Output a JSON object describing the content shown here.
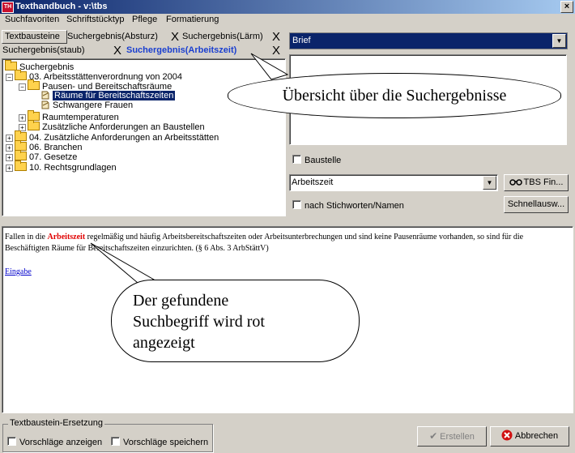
{
  "window": {
    "title": "Texthandbuch - v:\\tbs",
    "close_glyph": "×",
    "icon": "app-icon"
  },
  "menu": [
    "Suchfavoriten",
    "Schriftstücktyp",
    "Pflege",
    "Formatierung"
  ],
  "tabs": {
    "row1": [
      "Textbausteine",
      "Suchergebnis(Absturz)",
      "Suchergebnis(Lärm)"
    ],
    "row2": [
      "Suchergebnis(staub)",
      "Suchergebnis(Arbeitszeit)"
    ],
    "close_glyph": "X"
  },
  "tree": {
    "root": "Suchergebnis",
    "items": [
      "03. Arbeitsstättenverordnung von 2004",
      "Pausen- und Bereitschaftsräume",
      "Räume für Bereitschaftszeiten",
      "Schwangere Frauen",
      "Raumtemperaturen",
      "Zusätzliche Anforderungen an Baustellen",
      "04. Zusätzliche Anforderungen an Arbeitsstätten",
      "06. Branchen",
      "07. Gesetze",
      "10. Rechtsgrundlagen"
    ],
    "expand_glyph": "+",
    "collapse_glyph": "−"
  },
  "right_panel": {
    "doc_type": "Brief",
    "baustelle_label": "Baustelle",
    "search_value": "Arbeitszeit",
    "tbs_button": "TBS Fin...",
    "stichworte_label": "nach Stichworten/Namen",
    "schnell_button": "Schnellausw...",
    "dropdown_glyph": "▼"
  },
  "content": {
    "text_before": "Fallen in die ",
    "highlight": "Arbeitszeit",
    "text_after": " regelmäßig und häufig Arbeitsbereitschaftszeiten oder Arbeitsunterbrechungen und sind keine Pausenräume vorhanden, so sind für die Beschäftigten Räume für Bereitschaftszeiten einzurichten. (§ 6 Abs. 3 ArbStättV)",
    "link": "Eingabe",
    "highlight_color": "#e00000"
  },
  "callouts": {
    "top": "Übersicht über die Suchergebnisse",
    "bottom": "Der gefundene Suchbegriff wird rot angezeigt"
  },
  "bottom": {
    "group_label": "Textbaustein-Ersetzung",
    "vorschlaege_anzeigen": "Vorschläge anzeigen",
    "vorschlaege_speichern": "Vorschläge speichern",
    "erstellen": "Erstellen",
    "abbrechen": "Abbrechen"
  }
}
